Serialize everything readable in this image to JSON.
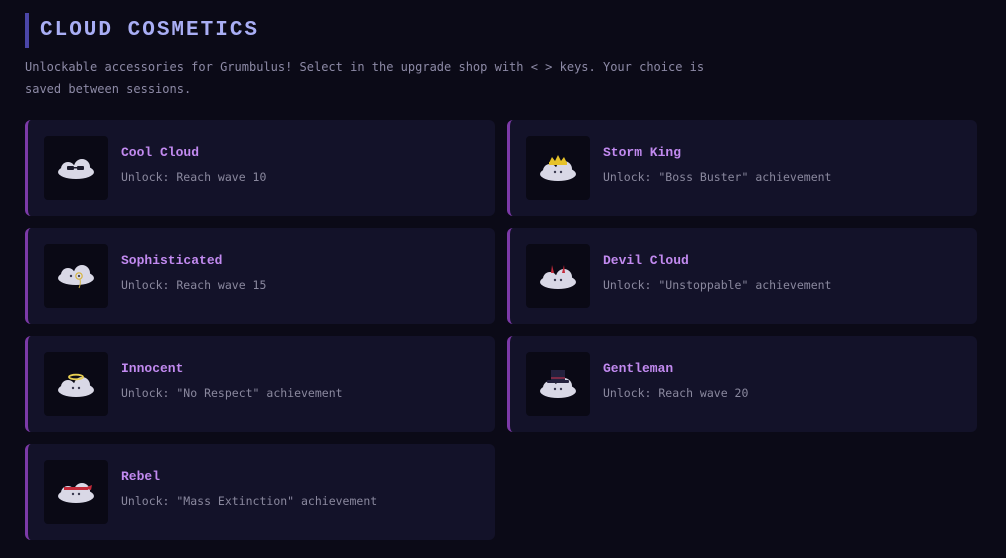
{
  "header": {
    "title": "CLOUD COSMETICS",
    "subtitle": "Unlockable accessories for Grumbulus! Select in the upgrade shop with < > keys. Your choice is saved between sessions."
  },
  "colors": {
    "background": "#0b0a17",
    "card": "#131229",
    "accent_border": "#7c3aa8",
    "title": "#a9aef5",
    "item_name": "#c28af0"
  },
  "cosmetics": [
    {
      "name": "Cool Cloud",
      "unlock": "Unlock: Reach wave 10",
      "icon": "cloud-sunglasses-icon"
    },
    {
      "name": "Storm King",
      "unlock": "Unlock: \"Boss Buster\" achievement",
      "icon": "cloud-crown-icon"
    },
    {
      "name": "Sophisticated",
      "unlock": "Unlock: Reach wave 15",
      "icon": "cloud-monocle-icon"
    },
    {
      "name": "Devil Cloud",
      "unlock": "Unlock: \"Unstoppable\" achievement",
      "icon": "cloud-devil-horns-icon"
    },
    {
      "name": "Innocent",
      "unlock": "Unlock: \"No Respect\" achievement",
      "icon": "cloud-halo-icon"
    },
    {
      "name": "Gentleman",
      "unlock": "Unlock: Reach wave 20",
      "icon": "cloud-top-hat-icon"
    },
    {
      "name": "Rebel",
      "unlock": "Unlock: \"Mass Extinction\" achievement",
      "icon": "cloud-bandana-icon"
    }
  ]
}
